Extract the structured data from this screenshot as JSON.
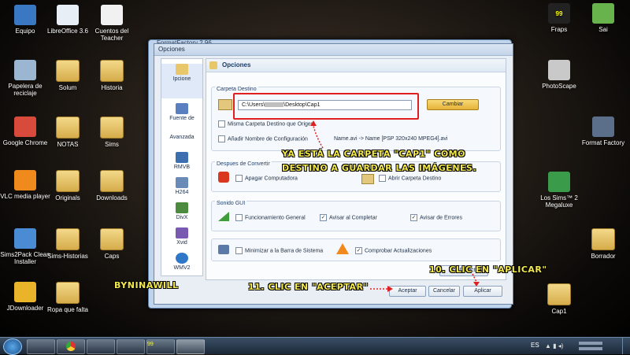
{
  "desktop": {
    "left_icons": [
      {
        "label": "Equipo",
        "icon": "computer-icon"
      },
      {
        "label": "Papelera de reciclaje",
        "icon": "recycle-bin-icon"
      },
      {
        "label": "Google Chrome",
        "icon": "chrome-icon"
      },
      {
        "label": "VLC media player",
        "icon": "vlc-icon"
      },
      {
        "label": "Sims2Pack Clean Installer",
        "icon": "installer-icon"
      },
      {
        "label": "JDownloader",
        "icon": "jdownloader-icon"
      }
    ],
    "col2_icons": [
      {
        "label": "LibreOffice 3.6",
        "icon": "libreoffice-icon"
      },
      {
        "label": "Solum",
        "icon": "folder-icon"
      },
      {
        "label": "NOTAS",
        "icon": "folder-icon"
      },
      {
        "label": "Originals",
        "icon": "folder-icon"
      },
      {
        "label": "Sims-Historias",
        "icon": "folder-icon"
      },
      {
        "label": "Ropa que falta",
        "icon": "folder-icon"
      }
    ],
    "col3_icons": [
      {
        "label": "Cuentos del Teacher",
        "icon": "document-icon"
      },
      {
        "label": "Historia",
        "icon": "folder-icon"
      },
      {
        "label": "Sims",
        "icon": "folder-icon"
      },
      {
        "label": "Downloads",
        "icon": "folder-icon"
      },
      {
        "label": "Caps",
        "icon": "folder-icon"
      }
    ],
    "right_icons": [
      {
        "label": "Fraps",
        "icon": "fraps-icon",
        "badge": "99"
      },
      {
        "label": "PhotoScape",
        "icon": "photoscape-icon"
      },
      {
        "label": "Los Sims™ 2 Megaluxe",
        "icon": "sims-icon"
      },
      {
        "label": "Cap1",
        "icon": "folder-icon"
      }
    ],
    "far_right_icons": [
      {
        "label": "Sai",
        "icon": "sai-icon"
      },
      {
        "label": "Format Factory",
        "icon": "format-factory-icon"
      },
      {
        "label": "Borrador",
        "icon": "folder-icon"
      }
    ]
  },
  "outer_window": {
    "title": "FormatFactory 2.96"
  },
  "dialog": {
    "title": "Opciones",
    "sidebar": [
      {
        "label": "Ipcione"
      },
      {
        "label": "Fuente de"
      },
      {
        "label": "Avanzada"
      },
      {
        "label": "RMVB"
      },
      {
        "label": "H264"
      },
      {
        "label": "DivX"
      },
      {
        "label": "Xvid"
      },
      {
        "label": "WMV2"
      }
    ],
    "header": "Opciones",
    "carpeta_destino": {
      "label": "Carpeta Destino",
      "path": "C:\\Users\\",
      "path_tail": "\\Desktop\\Cap1",
      "change_button": "Cambiar",
      "same_folder": "Misma Carpeta Destino que Origen",
      "add_config_name": "Añadir Nombre de Configuración",
      "example": "Name.avi -> Name [PSP 320x240 MPEG4].avi"
    },
    "despues": {
      "label": "Despues de Convertir",
      "shutdown": "Apagar Computadora",
      "open_folder": "Abrir Carpeta Destino"
    },
    "sonido": {
      "label": "Sonido GUI",
      "general": "Funcionamiento General",
      "on_complete": "Avisar al Completar",
      "on_error": "Avisar de Errores"
    },
    "misc": {
      "minimize": "Minimizar a la Barra de Sistema",
      "check_updates": "Comprobar Actualizaciones"
    },
    "default_button": "Por Defecto",
    "ok_button": "Aceptar",
    "cancel_button": "Cancelar",
    "apply_button": "Aplicar"
  },
  "annotations": {
    "carpeta_note_line1": "YA ESTÁ LA CARPETA \"CAP1\" COMO",
    "carpeta_note_line2": "DESTINO A GUARDAR LAS IMÁGENES.",
    "step10": "10. CLIC EN \"APLICAR\"",
    "step11": "11. CLIC EN \"ACEPTAR\"",
    "signature": "BYNINAWILL"
  },
  "taskbar": {
    "language": "ES",
    "fraps_badge": "99"
  },
  "colors": {
    "highlight_red": "#e02020",
    "annotation_yellow": "#f3e84a",
    "change_button": "#f2c64b"
  }
}
